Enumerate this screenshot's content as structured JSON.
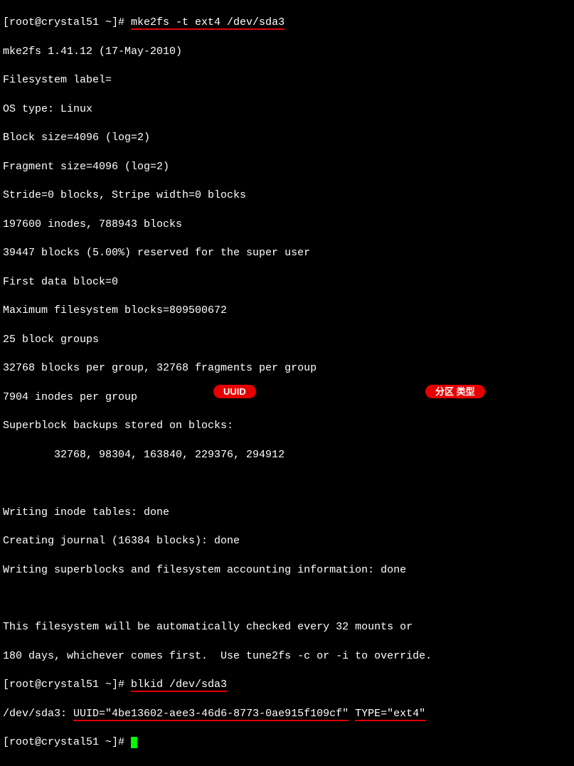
{
  "prompt1_a": "[root@crystal51 ~]# ",
  "cmd1": "mke2fs -t ext4 /dev/sda3",
  "out": {
    "l1": "mke2fs 1.41.12 (17-May-2010)",
    "l2": "Filesystem label=",
    "l3": "OS type: Linux",
    "l4": "Block size=4096 (log=2)",
    "l5": "Fragment size=4096 (log=2)",
    "l6": "Stride=0 blocks, Stripe width=0 blocks",
    "l7": "197600 inodes, 788943 blocks",
    "l8": "39447 blocks (5.00%) reserved for the super user",
    "l9": "First data block=0",
    "l10": "Maximum filesystem blocks=809500672",
    "l11": "25 block groups",
    "l12": "32768 blocks per group, 32768 fragments per group",
    "l13": "7904 inodes per group",
    "l14": "Superblock backups stored on blocks: ",
    "l15": "        32768, 98304, 163840, 229376, 294912",
    "l16": "Writing inode tables: done                            ",
    "l17": "Creating journal (16384 blocks): done",
    "l18": "Writing superblocks and filesystem accounting information: done",
    "l19": "This filesystem will be automatically checked every 32 mounts or",
    "l20": "180 days, whichever comes first.  Use tune2fs -c or -i to override."
  },
  "prompt2_a": "[root@crystal51 ~]# ",
  "cmd2": "blkid /dev/sda3",
  "blkline": {
    "dev": "/dev/sda3: ",
    "uuidkey": "UUID=",
    "uuidval": "\"4be13602-aee3-46d6-8773-0ae915f109cf\"",
    "spacer": " ",
    "typekey": "TYPE=",
    "typeval": "\"ext4\""
  },
  "prompt3_a": "[root@crystal51 ~]# ",
  "badges": {
    "uuid": "UUID",
    "ptype": "分区 类型"
  }
}
